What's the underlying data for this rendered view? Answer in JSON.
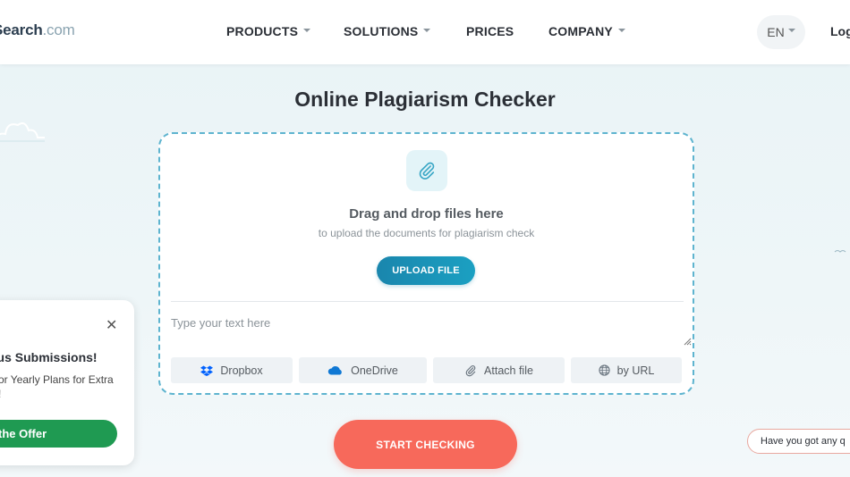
{
  "header": {
    "logo_main": "Search",
    "logo_domain": ".com",
    "nav": [
      {
        "label": "PRODUCTS",
        "has_caret": true
      },
      {
        "label": "SOLUTIONS",
        "has_caret": true
      },
      {
        "label": "PRICES",
        "has_caret": false
      },
      {
        "label": "COMPANY",
        "has_caret": true
      }
    ],
    "language": "EN",
    "login": "Log"
  },
  "main": {
    "title": "Online Plagiarism Checker",
    "upload": {
      "icon": "paperclip-icon",
      "drag_title": "Drag and drop files here",
      "drag_subtitle": "to upload the documents for plagiarism check",
      "upload_button": "UPLOAD FILE"
    },
    "text_input": {
      "placeholder": "Type your text here",
      "value": ""
    },
    "sources": [
      {
        "label": "Dropbox",
        "icon": "dropbox-icon"
      },
      {
        "label": "OneDrive",
        "icon": "onedrive-icon"
      },
      {
        "label": "Attach file",
        "icon": "paperclip-icon"
      },
      {
        "label": "by URL",
        "icon": "globe-icon"
      }
    ],
    "start_button": "START CHECKING"
  },
  "promo": {
    "title": "nus Submissions!",
    "text": "or Yearly Plans for Extra\n!",
    "button": "the Offer"
  },
  "chat": {
    "text": "Have you got any q"
  },
  "colors": {
    "accent": "#1a86ad",
    "start": "#f7695b",
    "promo_button": "#1f9a52",
    "dashed_border": "#5eb4cf"
  }
}
